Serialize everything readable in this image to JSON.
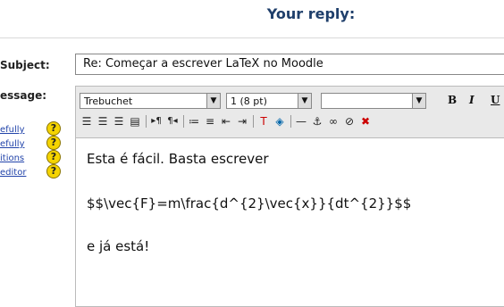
{
  "heading": "Your reply:",
  "labels": {
    "subject": "Subject:",
    "message": "essage:"
  },
  "subject_value": "Re: Começar a escrever LaTeX no Moodle",
  "toolbar": {
    "font_family": "Trebuchet",
    "font_size": "1 (8 pt)",
    "heading_format": "",
    "bold": "B",
    "italic": "I",
    "underline": "U"
  },
  "help_links": [
    "efully",
    "efully",
    "itions",
    "editor"
  ],
  "help_icon_glyph": "?",
  "message_lines": [
    "Esta é fácil. Basta escrever",
    "$$\\vec{F}=m\\frac{d^{2}\\vec{x}}{dt^{2}}$$",
    "e já está!"
  ],
  "toolbar_icons": [
    "align-left-icon",
    "align-center-icon",
    "align-right-icon",
    "justify-icon",
    "ltr-icon",
    "rtl-icon",
    "ordered-list-icon",
    "unordered-list-icon",
    "outdent-icon",
    "indent-icon",
    "text-color-icon",
    "background-color-icon",
    "horizontal-rule-icon",
    "anchor-icon",
    "link-icon",
    "unlink-icon",
    "remove-icon"
  ]
}
